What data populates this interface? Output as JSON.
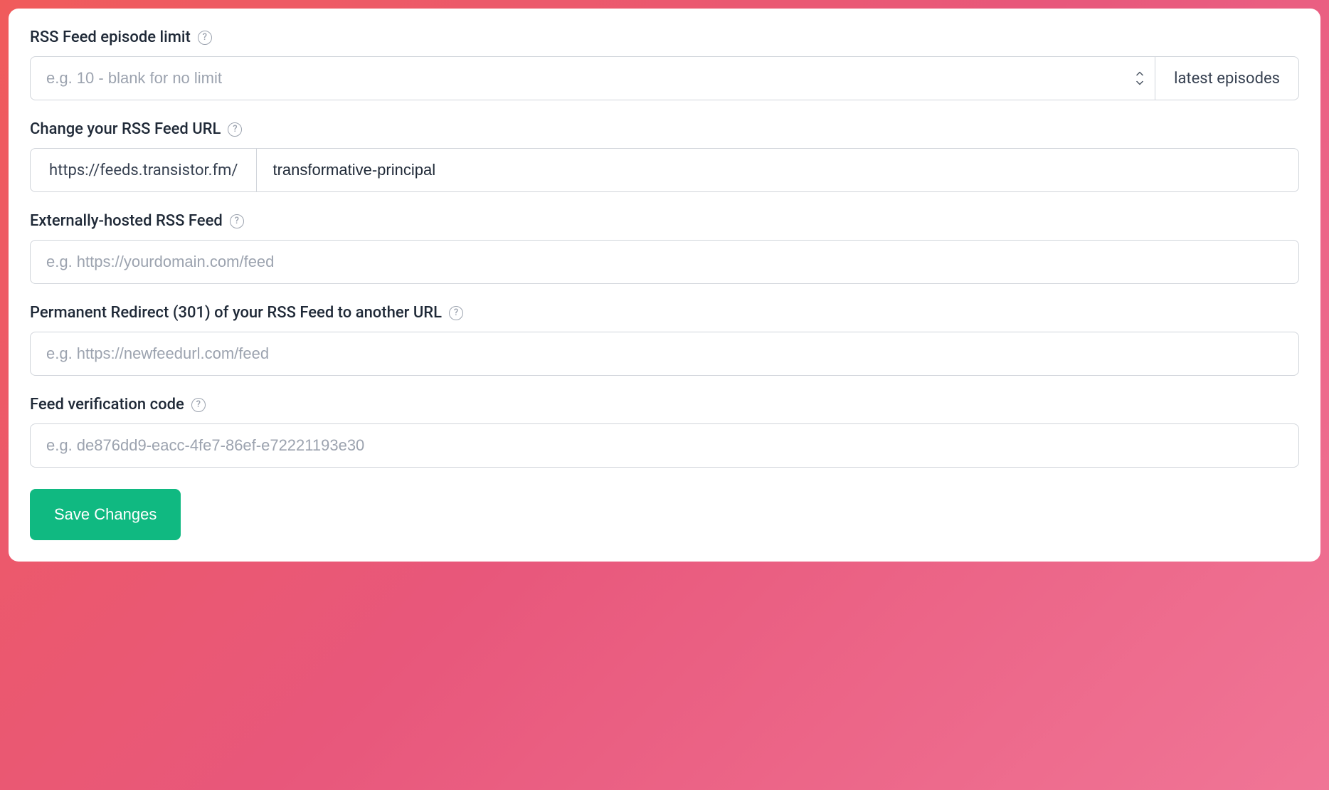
{
  "fields": {
    "episode_limit": {
      "label": "RSS Feed episode limit",
      "placeholder": "e.g. 10 - blank for no limit",
      "value": "",
      "suffix_option": "latest episodes"
    },
    "feed_url": {
      "label": "Change your RSS Feed URL",
      "prefix": "https://feeds.transistor.fm/",
      "value": "transformative-principal"
    },
    "external_feed": {
      "label": "Externally-hosted RSS Feed",
      "placeholder": "e.g. https://yourdomain.com/feed",
      "value": ""
    },
    "redirect": {
      "label": "Permanent Redirect (301) of your RSS Feed to another URL",
      "placeholder": "e.g. https://newfeedurl.com/feed",
      "value": ""
    },
    "verification": {
      "label": "Feed verification code",
      "placeholder": "e.g. de876dd9-eacc-4fe7-86ef-e72221193e30",
      "value": ""
    }
  },
  "actions": {
    "save_label": "Save Changes"
  },
  "help_glyph": "?"
}
